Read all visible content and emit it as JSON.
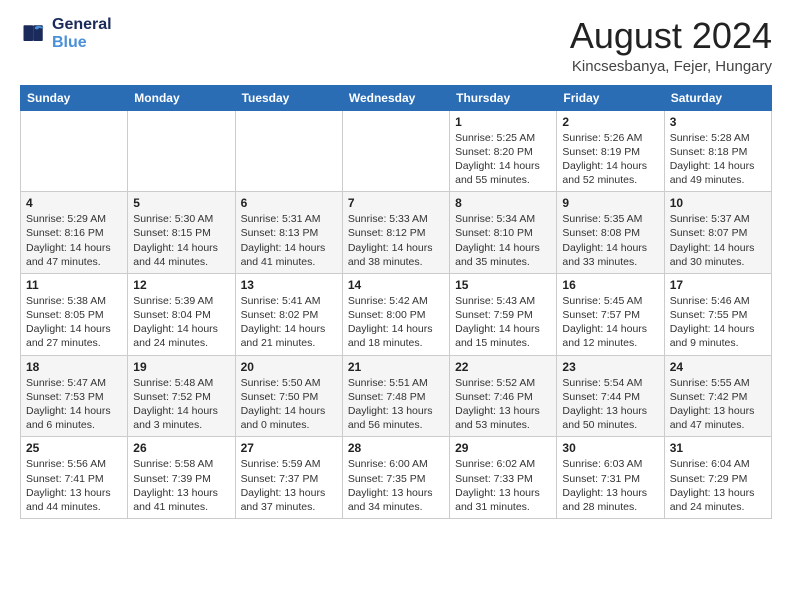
{
  "header": {
    "logo_line1": "General",
    "logo_line2": "Blue",
    "month_title": "August 2024",
    "location": "Kincsesbanya, Fejer, Hungary"
  },
  "days_of_week": [
    "Sunday",
    "Monday",
    "Tuesday",
    "Wednesday",
    "Thursday",
    "Friday",
    "Saturday"
  ],
  "weeks": [
    [
      {
        "day": "",
        "info": ""
      },
      {
        "day": "",
        "info": ""
      },
      {
        "day": "",
        "info": ""
      },
      {
        "day": "",
        "info": ""
      },
      {
        "day": "1",
        "info": "Sunrise: 5:25 AM\nSunset: 8:20 PM\nDaylight: 14 hours\nand 55 minutes."
      },
      {
        "day": "2",
        "info": "Sunrise: 5:26 AM\nSunset: 8:19 PM\nDaylight: 14 hours\nand 52 minutes."
      },
      {
        "day": "3",
        "info": "Sunrise: 5:28 AM\nSunset: 8:18 PM\nDaylight: 14 hours\nand 49 minutes."
      }
    ],
    [
      {
        "day": "4",
        "info": "Sunrise: 5:29 AM\nSunset: 8:16 PM\nDaylight: 14 hours\nand 47 minutes."
      },
      {
        "day": "5",
        "info": "Sunrise: 5:30 AM\nSunset: 8:15 PM\nDaylight: 14 hours\nand 44 minutes."
      },
      {
        "day": "6",
        "info": "Sunrise: 5:31 AM\nSunset: 8:13 PM\nDaylight: 14 hours\nand 41 minutes."
      },
      {
        "day": "7",
        "info": "Sunrise: 5:33 AM\nSunset: 8:12 PM\nDaylight: 14 hours\nand 38 minutes."
      },
      {
        "day": "8",
        "info": "Sunrise: 5:34 AM\nSunset: 8:10 PM\nDaylight: 14 hours\nand 35 minutes."
      },
      {
        "day": "9",
        "info": "Sunrise: 5:35 AM\nSunset: 8:08 PM\nDaylight: 14 hours\nand 33 minutes."
      },
      {
        "day": "10",
        "info": "Sunrise: 5:37 AM\nSunset: 8:07 PM\nDaylight: 14 hours\nand 30 minutes."
      }
    ],
    [
      {
        "day": "11",
        "info": "Sunrise: 5:38 AM\nSunset: 8:05 PM\nDaylight: 14 hours\nand 27 minutes."
      },
      {
        "day": "12",
        "info": "Sunrise: 5:39 AM\nSunset: 8:04 PM\nDaylight: 14 hours\nand 24 minutes."
      },
      {
        "day": "13",
        "info": "Sunrise: 5:41 AM\nSunset: 8:02 PM\nDaylight: 14 hours\nand 21 minutes."
      },
      {
        "day": "14",
        "info": "Sunrise: 5:42 AM\nSunset: 8:00 PM\nDaylight: 14 hours\nand 18 minutes."
      },
      {
        "day": "15",
        "info": "Sunrise: 5:43 AM\nSunset: 7:59 PM\nDaylight: 14 hours\nand 15 minutes."
      },
      {
        "day": "16",
        "info": "Sunrise: 5:45 AM\nSunset: 7:57 PM\nDaylight: 14 hours\nand 12 minutes."
      },
      {
        "day": "17",
        "info": "Sunrise: 5:46 AM\nSunset: 7:55 PM\nDaylight: 14 hours\nand 9 minutes."
      }
    ],
    [
      {
        "day": "18",
        "info": "Sunrise: 5:47 AM\nSunset: 7:53 PM\nDaylight: 14 hours\nand 6 minutes."
      },
      {
        "day": "19",
        "info": "Sunrise: 5:48 AM\nSunset: 7:52 PM\nDaylight: 14 hours\nand 3 minutes."
      },
      {
        "day": "20",
        "info": "Sunrise: 5:50 AM\nSunset: 7:50 PM\nDaylight: 14 hours\nand 0 minutes."
      },
      {
        "day": "21",
        "info": "Sunrise: 5:51 AM\nSunset: 7:48 PM\nDaylight: 13 hours\nand 56 minutes."
      },
      {
        "day": "22",
        "info": "Sunrise: 5:52 AM\nSunset: 7:46 PM\nDaylight: 13 hours\nand 53 minutes."
      },
      {
        "day": "23",
        "info": "Sunrise: 5:54 AM\nSunset: 7:44 PM\nDaylight: 13 hours\nand 50 minutes."
      },
      {
        "day": "24",
        "info": "Sunrise: 5:55 AM\nSunset: 7:42 PM\nDaylight: 13 hours\nand 47 minutes."
      }
    ],
    [
      {
        "day": "25",
        "info": "Sunrise: 5:56 AM\nSunset: 7:41 PM\nDaylight: 13 hours\nand 44 minutes."
      },
      {
        "day": "26",
        "info": "Sunrise: 5:58 AM\nSunset: 7:39 PM\nDaylight: 13 hours\nand 41 minutes."
      },
      {
        "day": "27",
        "info": "Sunrise: 5:59 AM\nSunset: 7:37 PM\nDaylight: 13 hours\nand 37 minutes."
      },
      {
        "day": "28",
        "info": "Sunrise: 6:00 AM\nSunset: 7:35 PM\nDaylight: 13 hours\nand 34 minutes."
      },
      {
        "day": "29",
        "info": "Sunrise: 6:02 AM\nSunset: 7:33 PM\nDaylight: 13 hours\nand 31 minutes."
      },
      {
        "day": "30",
        "info": "Sunrise: 6:03 AM\nSunset: 7:31 PM\nDaylight: 13 hours\nand 28 minutes."
      },
      {
        "day": "31",
        "info": "Sunrise: 6:04 AM\nSunset: 7:29 PM\nDaylight: 13 hours\nand 24 minutes."
      }
    ]
  ]
}
